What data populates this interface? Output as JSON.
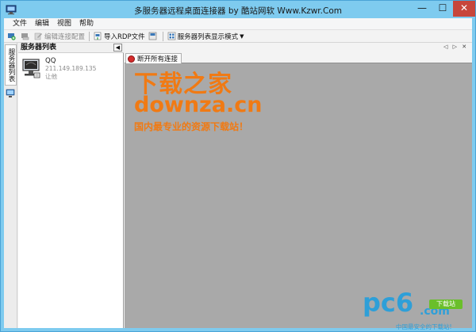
{
  "window": {
    "title": "多服务器远程桌面连接器 by 酷站网软 Www.Kzwr.Com",
    "controls": {
      "minimize": "—",
      "maximize": "☐",
      "close": "✕"
    }
  },
  "menu": [
    "文件",
    "编辑",
    "视图",
    "帮助"
  ],
  "toolbar": {
    "edit_config": "编辑连接配置",
    "import_rdp": "导入RDP文件",
    "display_mode": "服务器列表显示模式"
  },
  "sidebar": {
    "tab_label": "服务器列表"
  },
  "panel": {
    "title": "服务器列表",
    "pin": "◀",
    "servers": [
      {
        "name": "QQ",
        "ip": "211.149.189.135",
        "user": "让他"
      }
    ]
  },
  "tabs": [
    {
      "label": "断开所有连接"
    }
  ],
  "nav": {
    "arrows": "◁ ▷ ✕"
  },
  "watermarks": {
    "brand_cn": "下载之家",
    "brand_url": "downza.cn",
    "brand_slogan": "国内最专业的资源下载站！",
    "pc6": "pc6",
    "pc6_com": ".com",
    "pc6_badge": "下载站",
    "pc6_tag": "中国最安全的下载站!"
  },
  "colors": {
    "titlebar": "#7ecbef",
    "close_button": "#c7463b",
    "workspace": "#a9a9a9",
    "watermark_orange": "#f07a14",
    "watermark_blue": "#2e9fd8"
  }
}
